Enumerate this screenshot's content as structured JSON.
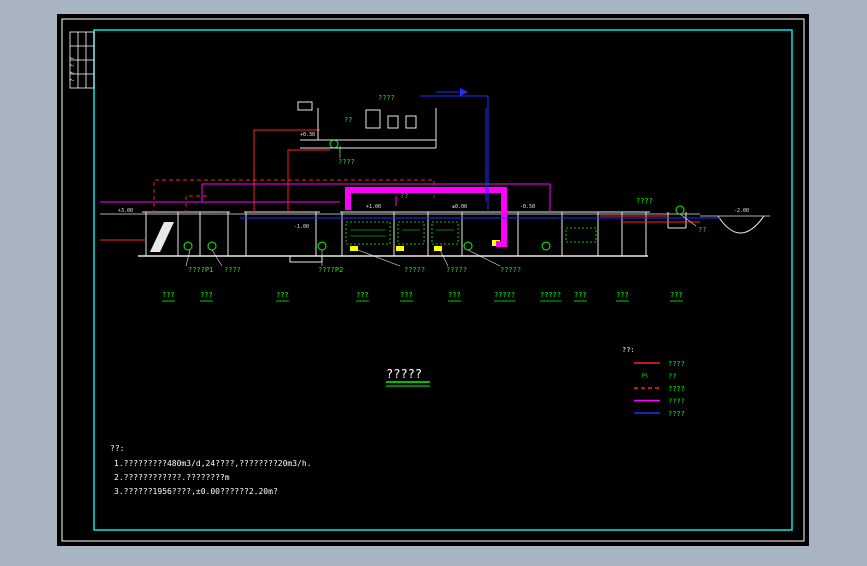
{
  "colors": {
    "viewport_bg": "#a9b4c2",
    "sheet_bg": "#000000",
    "border": "#ffffff",
    "frame": "#00e5e5",
    "label": "#00ff00",
    "pipe_red": "#ff2020",
    "pipe_magenta": "#ff00ff",
    "pipe_blue": "#2030ff",
    "equipment": "#ffff00",
    "structure": "#e8e8e8"
  },
  "title_block": {
    "label": "? ? ? ?"
  },
  "drawing": {
    "title": "?????",
    "top_labels": {
      "chemical_house": "????",
      "feeder": "??",
      "blower": "????",
      "odor": "????",
      "recycle": "??"
    },
    "tag_labels": [
      "????P1",
      "????",
      "????P2",
      "?????",
      "?????",
      "?????",
      "??"
    ],
    "tank_names": [
      "???",
      "???",
      "???",
      "???",
      "???",
      "???",
      "?????",
      "?????",
      "???",
      "???",
      "???"
    ],
    "small_tags": [
      "+3.00",
      "-1.00",
      "+1.00",
      "±0.00",
      "-0.50",
      "+0.30",
      "-2.00"
    ]
  },
  "legend": {
    "title": "??:",
    "items": [
      {
        "label": "????",
        "color": "#ff2020",
        "style": "solid",
        "tag": ""
      },
      {
        "label": "??",
        "color": "#00ff00",
        "style": "tag",
        "tag": "PS"
      },
      {
        "label": "????",
        "color": "#ff2020",
        "style": "dashed",
        "tag": ""
      },
      {
        "label": "????",
        "color": "#ff00ff",
        "style": "solid",
        "tag": ""
      },
      {
        "label": "????",
        "color": "#2030ff",
        "style": "solid",
        "tag": ""
      }
    ]
  },
  "notes": {
    "title": "??:",
    "lines": [
      "1.?????????480m3/d,24????,????????20m3/h.",
      "2.????????????.????????m",
      "3.??????1956????,±0.00??????2.20m?"
    ]
  }
}
